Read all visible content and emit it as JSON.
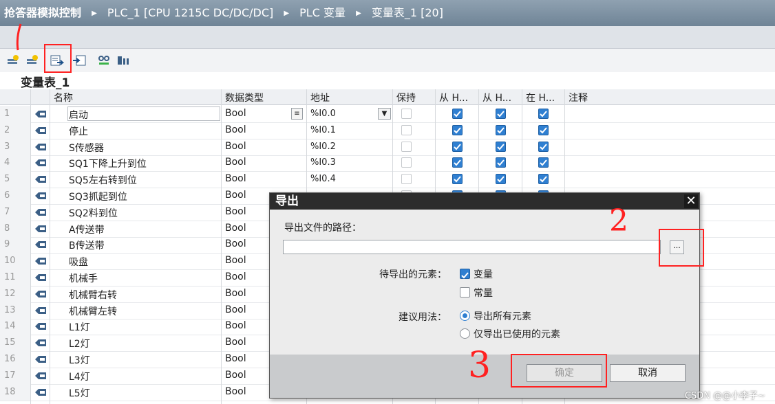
{
  "breadcrumb": {
    "project": "抢答器模拟控制",
    "device": "PLC_1 [CPU 1215C DC/DC/DC]",
    "folder": "PLC 变量",
    "table": "变量表_1 [20]"
  },
  "toolbar": {
    "icons": [
      "add-variable-icon",
      "insert-row-icon",
      "export-icon",
      "import-icon",
      "monitor-icon",
      "reload-icon"
    ]
  },
  "table_title": "变量表_1",
  "columns": [
    "名称",
    "数据类型",
    "地址",
    "保持",
    "从 H...",
    "从 H...",
    "在 H...",
    "注释"
  ],
  "rows": [
    {
      "num": "1",
      "name": "启动",
      "type": "Bool",
      "addr": "%I0.0"
    },
    {
      "num": "2",
      "name": "停止",
      "type": "Bool",
      "addr": "%I0.1"
    },
    {
      "num": "3",
      "name": "S传感器",
      "type": "Bool",
      "addr": "%I0.2"
    },
    {
      "num": "4",
      "name": "SQ1下降上升到位",
      "type": "Bool",
      "addr": "%I0.3"
    },
    {
      "num": "5",
      "name": "SQ5左右转到位",
      "type": "Bool",
      "addr": "%I0.4"
    },
    {
      "num": "6",
      "name": "SQ3抓起到位",
      "type": "Bool",
      "addr": ""
    },
    {
      "num": "7",
      "name": "SQ2料到位",
      "type": "Bool",
      "addr": ""
    },
    {
      "num": "8",
      "name": "A传送带",
      "type": "Bool",
      "addr": ""
    },
    {
      "num": "9",
      "name": "B传送带",
      "type": "Bool",
      "addr": ""
    },
    {
      "num": "10",
      "name": "吸盘",
      "type": "Bool",
      "addr": ""
    },
    {
      "num": "11",
      "name": "机械手",
      "type": "Bool",
      "addr": ""
    },
    {
      "num": "12",
      "name": "机械臂右转",
      "type": "Bool",
      "addr": ""
    },
    {
      "num": "13",
      "name": "机械臂左转",
      "type": "Bool",
      "addr": ""
    },
    {
      "num": "14",
      "name": "L1灯",
      "type": "Bool",
      "addr": ""
    },
    {
      "num": "15",
      "name": "L2灯",
      "type": "Bool",
      "addr": ""
    },
    {
      "num": "16",
      "name": "L3灯",
      "type": "Bool",
      "addr": ""
    },
    {
      "num": "17",
      "name": "L4灯",
      "type": "Bool",
      "addr": ""
    },
    {
      "num": "18",
      "name": "L5灯",
      "type": "Bool",
      "addr": ""
    }
  ],
  "dialog": {
    "title": "导出",
    "path_label": "导出文件的路径：",
    "path_value": "",
    "browse_label": "...",
    "elements_label": "待导出的元素：",
    "opt_variables": "变量",
    "opt_constants": "常量",
    "usage_label": "建议用法：",
    "opt_export_all": "导出所有元素",
    "opt_export_used": "仅导出已使用的元素",
    "ok_label": "确定",
    "cancel_label": "取消",
    "variables_checked": true,
    "constants_checked": false,
    "selected_usage": "导出所有元素"
  },
  "annotations": {
    "step2": "2",
    "step3": "3"
  },
  "watermark": "CSDN @@小李子~",
  "colors": {
    "crumb_bg": "#7a8d9f",
    "check_blue": "#2f7fd1",
    "annotation_red": "#ff2121",
    "dialog_title": "#2c2c2c"
  }
}
